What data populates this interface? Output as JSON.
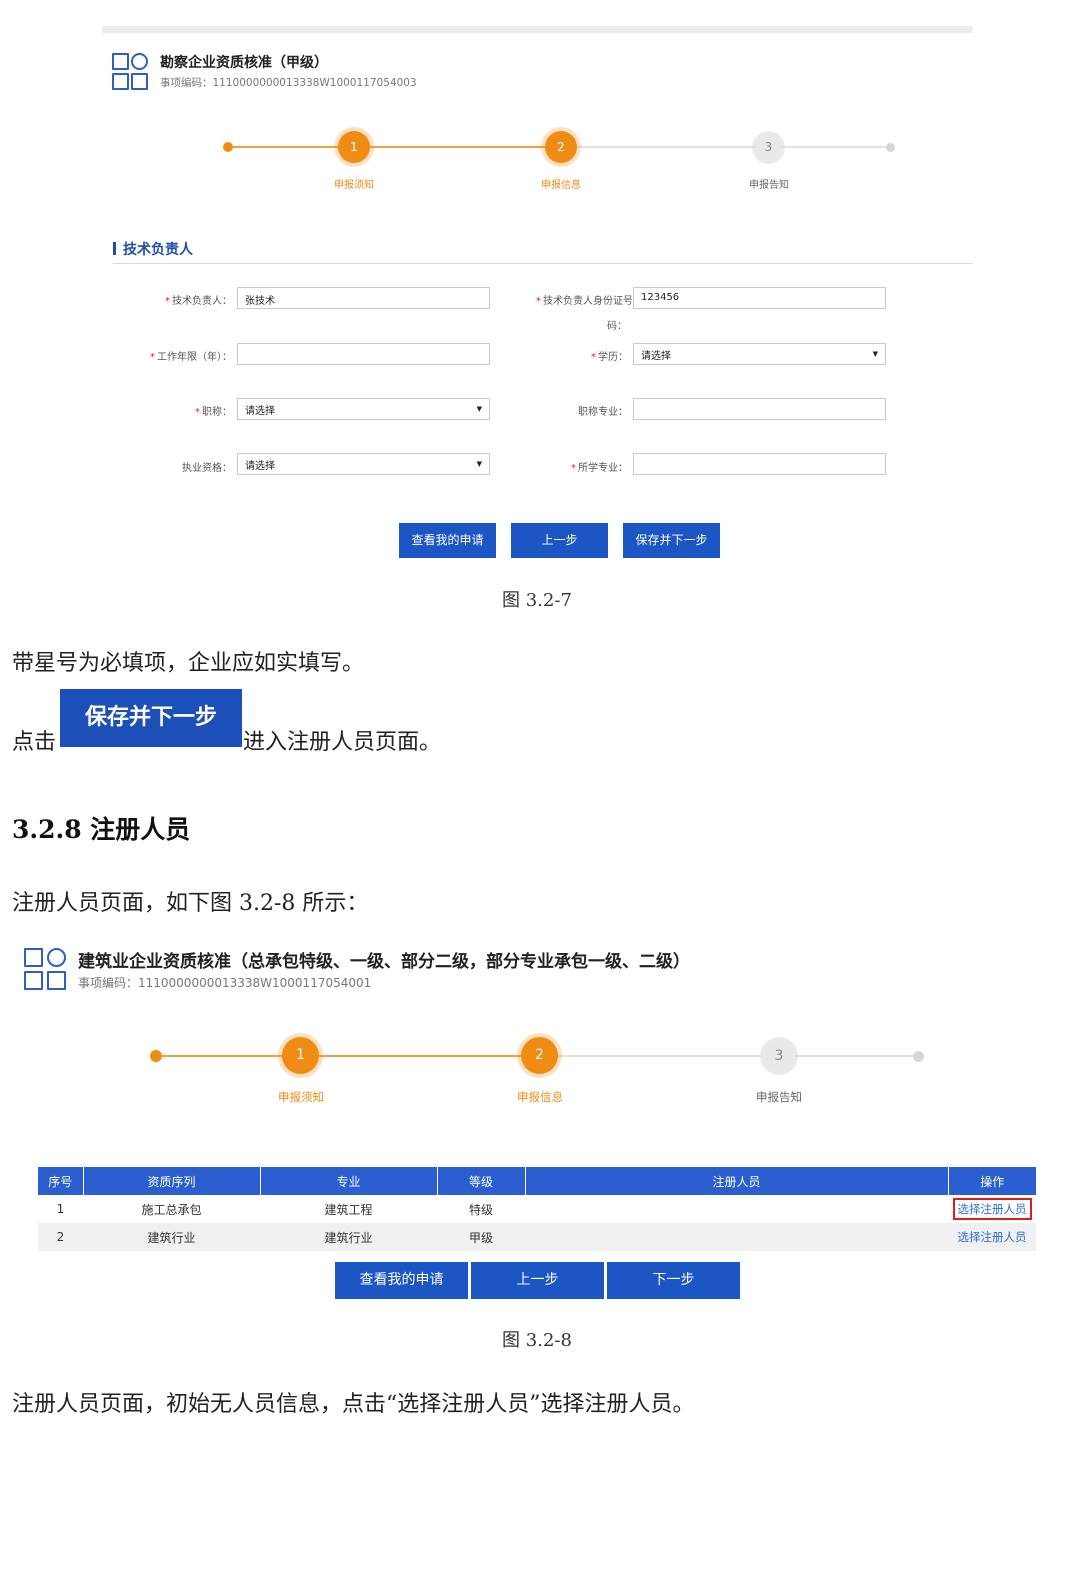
{
  "fig1": {
    "service": {
      "title": "勘察企业资质核准（甲级）",
      "code": "事项编码：1110000000013338W1000117054003"
    },
    "steps": [
      {
        "num": "1",
        "label": "申报须知"
      },
      {
        "num": "2",
        "label": "申报信息"
      },
      {
        "num": "3",
        "label": "申报告知"
      }
    ],
    "section_title": "技术负责人",
    "fields": {
      "tech_lead": {
        "label": "技术负责人：",
        "value": "张技术",
        "required": true
      },
      "id_no": {
        "label_line1": "技术负责人身份证号",
        "label_line2": "码：",
        "value": "123456",
        "required": true
      },
      "years": {
        "label": "工作年限（年）：",
        "value": "",
        "required": true
      },
      "education": {
        "label": "学历：",
        "value": "请选择",
        "required": true
      },
      "title": {
        "label": "职称：",
        "value": "请选择",
        "required": true
      },
      "title_major": {
        "label": "职称专业：",
        "value": "",
        "required": false
      },
      "qualification": {
        "label": "执业资格：",
        "value": "请选择",
        "required": false
      },
      "major": {
        "label": "所学专业：",
        "value": "",
        "required": true
      }
    },
    "buttons": {
      "view": "查看我的申请",
      "prev": "上一步",
      "save_next": "保存并下一步"
    },
    "caption": "图 3.2-7"
  },
  "text": {
    "p1": "带星号为必填项，企业应如实填写。",
    "p2_before": "点击",
    "p2_button": "保存并下一步",
    "p2_after": "进入注册人员页面。",
    "heading": "3.2.8 注册人员",
    "p3": "注册人员页面，如下图 3.2-8 所示：",
    "p4": "注册人员页面，初始无人员信息，点击“选择注册人员”选择注册人员。"
  },
  "fig2": {
    "service": {
      "title": "建筑业企业资质核准（总承包特级、一级、部分二级，部分专业承包一级、二级）",
      "code": "事项编码：1110000000013338W1000117054001"
    },
    "steps": [
      {
        "num": "1",
        "label": "申报须知"
      },
      {
        "num": "2",
        "label": "申报信息"
      },
      {
        "num": "3",
        "label": "申报告知"
      }
    ],
    "table": {
      "headers": [
        "序号",
        "资质序列",
        "专业",
        "等级",
        "注册人员",
        "操作"
      ],
      "rows": [
        {
          "no": "1",
          "series": "施工总承包",
          "major": "建筑工程",
          "grade": "特级",
          "staff": "",
          "op": "选择注册人员"
        },
        {
          "no": "2",
          "series": "建筑行业",
          "major": "建筑行业",
          "grade": "甲级",
          "staff": "",
          "op": "选择注册人员"
        }
      ]
    },
    "buttons": {
      "view": "查看我的申请",
      "prev": "上一步",
      "next": "下一步"
    },
    "caption": "图 3.2-8"
  },
  "colors": {
    "accent_blue": "#1c56c4",
    "step_orange": "#f08c14",
    "required_red": "#e02020",
    "highlight_red": "#e21c1c"
  }
}
